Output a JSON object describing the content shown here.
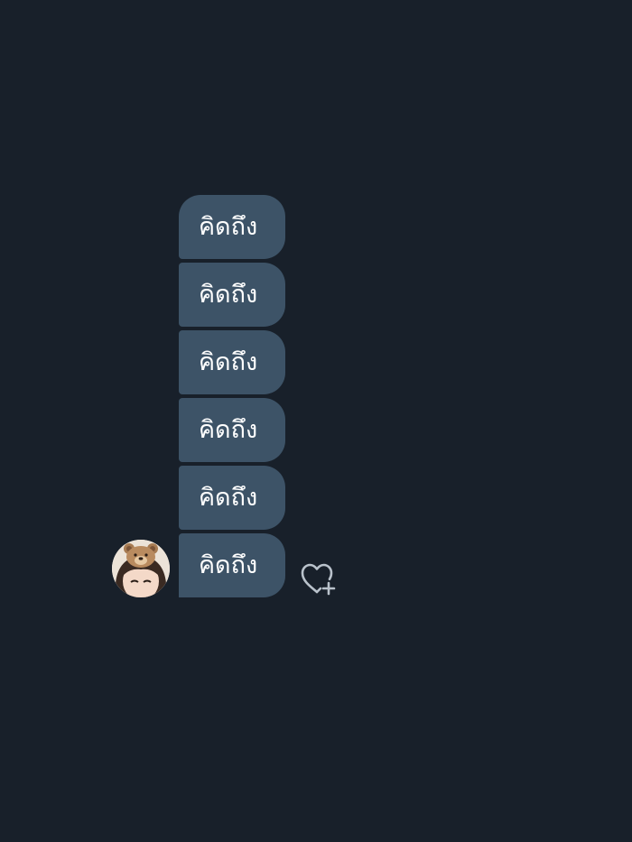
{
  "conversation": {
    "messages": [
      {
        "text": "คิดถึง"
      },
      {
        "text": "คิดถึง"
      },
      {
        "text": "คิดถึง"
      },
      {
        "text": "คิดถึง"
      },
      {
        "text": "คิดถึง"
      },
      {
        "text": "คิดถึง"
      }
    ]
  },
  "icons": {
    "reaction": "heart-plus-icon",
    "avatar": "user-avatar-bear-headband"
  },
  "colors": {
    "background": "#18202a",
    "bubble": "#3d5367",
    "text": "#ffffff",
    "icon": "#b9c2cb"
  }
}
